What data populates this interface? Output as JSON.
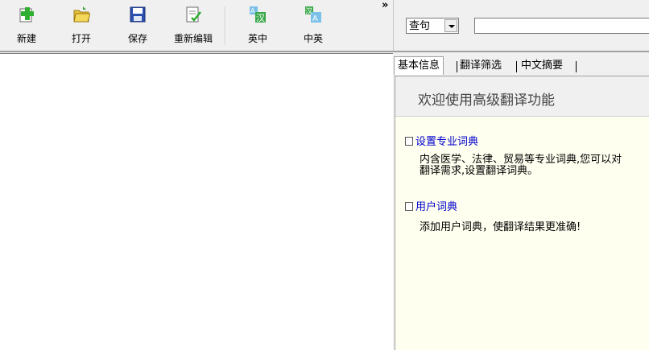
{
  "toolbar": {
    "buttons": [
      {
        "label": "新建",
        "icon": "new-doc-plus-icon"
      },
      {
        "label": "打开",
        "icon": "open-folder-icon"
      },
      {
        "label": "保存",
        "icon": "save-floppy-icon"
      },
      {
        "label": "重新编辑",
        "icon": "re-edit-icon"
      },
      {
        "label": "英中",
        "icon": "en-to-zh-icon"
      },
      {
        "label": "中英",
        "icon": "zh-to-en-icon"
      }
    ],
    "overflow": "»"
  },
  "query": {
    "mode": "查句",
    "input_value": ""
  },
  "tabs": [
    "基本信息",
    "翻译筛选",
    "中文摘要"
  ],
  "panel": {
    "banner": "欢迎使用高级翻译功能",
    "sections": [
      {
        "title": "设置专业词典",
        "lines": [
          "内含医学、法律、贸易等专业词典,您可以对",
          "翻译需求,设置翻译词典。"
        ]
      },
      {
        "title": "用户词典",
        "lines": [
          "添加用户词典，使翻译结果更准确!"
        ]
      }
    ]
  },
  "colors": {
    "link": "#0000cc",
    "panel_bg": "#fffff0",
    "chrome": "#f0f0f0"
  }
}
